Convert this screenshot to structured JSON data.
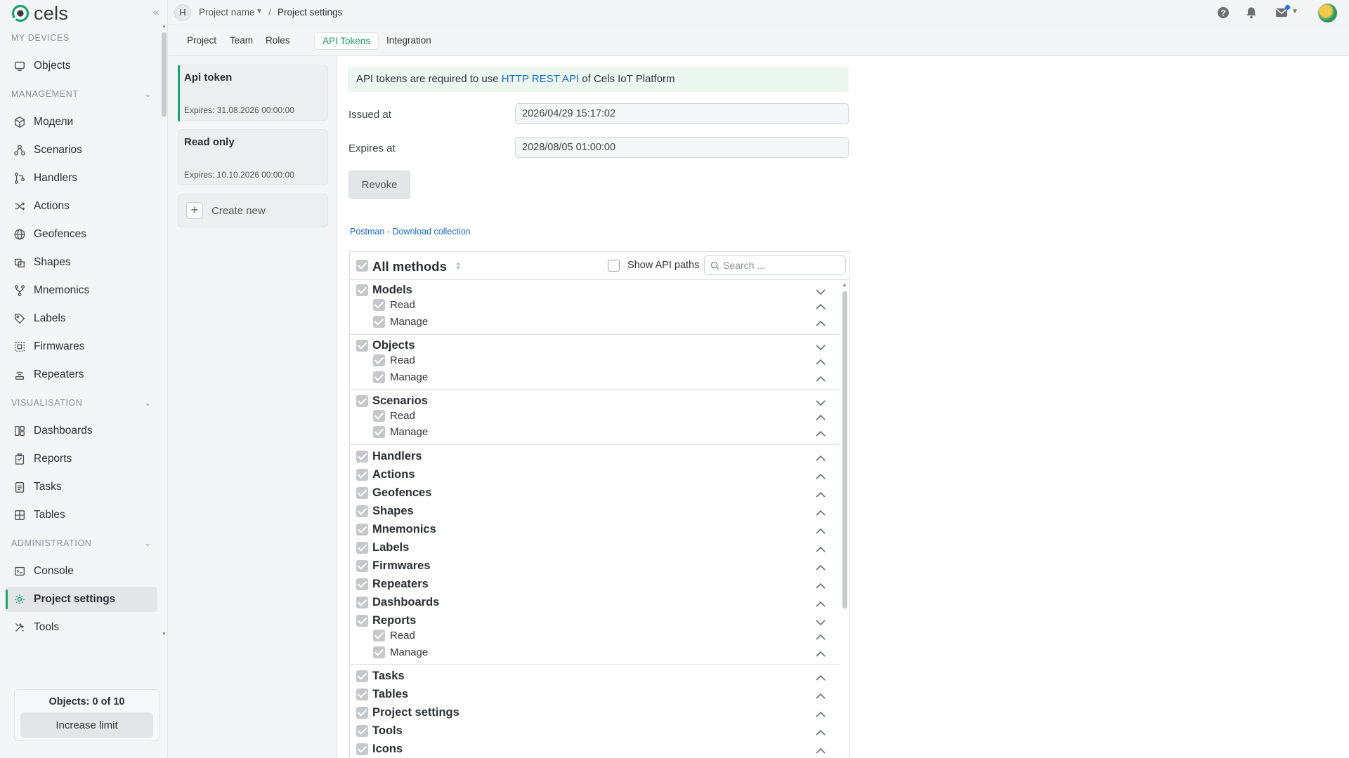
{
  "app": {
    "logo_text": "cels"
  },
  "sidebar": {
    "sections": {
      "devices": "MY DEVICES",
      "management": "MANAGEMENT",
      "visualisation": "VISUALISATION",
      "administration": "ADMINISTRATION"
    },
    "items": {
      "objects": "Objects",
      "models": "Модели",
      "scenarios": "Scenarios",
      "handlers": "Handlers",
      "actions": "Actions",
      "geofences": "Geofences",
      "shapes": "Shapes",
      "mnemonics": "Mnemonics",
      "labels": "Labels",
      "firmwares": "Firmwares",
      "repeaters": "Repeaters",
      "dashboards": "Dashboards",
      "reports": "Reports",
      "tasks": "Tasks",
      "tables": "Tables",
      "console": "Console",
      "project_settings": "Project settings",
      "tools": "Tools"
    },
    "limit": {
      "text": "Objects: 0 of 10",
      "button": "Increase limit"
    }
  },
  "header": {
    "project_initial": "H",
    "project_name": "Project name",
    "separator": "/",
    "current": "Project settings"
  },
  "tabs": [
    "Project",
    "Team",
    "Roles",
    "API Tokens",
    "Integration"
  ],
  "tokens": [
    {
      "name": "Api token",
      "expires": "Expires: 31.08.2026 00:00:00"
    },
    {
      "name": "Read only",
      "expires": "Expires: 10.10.2026 00:00:00"
    }
  ],
  "create_new": "Create new",
  "main": {
    "info_prefix": "API tokens are required to use ",
    "info_link": "HTTP REST API",
    "info_suffix": " of Cels IoT Platform",
    "issued_label": "Issued at",
    "issued_value": "2026/04/29 15:17:02",
    "expires_label": "Expires at",
    "expires_value": "2028/08/05 01:00:00",
    "revoke": "Revoke",
    "postman": "Postman - Download collection"
  },
  "methods": {
    "all_label": "All methods",
    "show_paths": "Show API paths",
    "search_placeholder": "Search ...",
    "read": "Read",
    "manage": "Manage",
    "groups": {
      "models": "Models",
      "objects": "Objects",
      "scenarios": "Scenarios",
      "handlers": "Handlers",
      "actions": "Actions",
      "geofences": "Geofences",
      "shapes": "Shapes",
      "mnemonics": "Mnemonics",
      "labels": "Labels",
      "firmwares": "Firmwares",
      "repeaters": "Repeaters",
      "dashboards": "Dashboards",
      "reports": "Reports",
      "tasks": "Tasks",
      "tables": "Tables",
      "project_settings": "Project settings",
      "tools": "Tools",
      "icons": "Icons"
    }
  },
  "colors": {
    "accent": "#1aa36a",
    "link": "#1366c8",
    "banner": "#edf7f2"
  }
}
